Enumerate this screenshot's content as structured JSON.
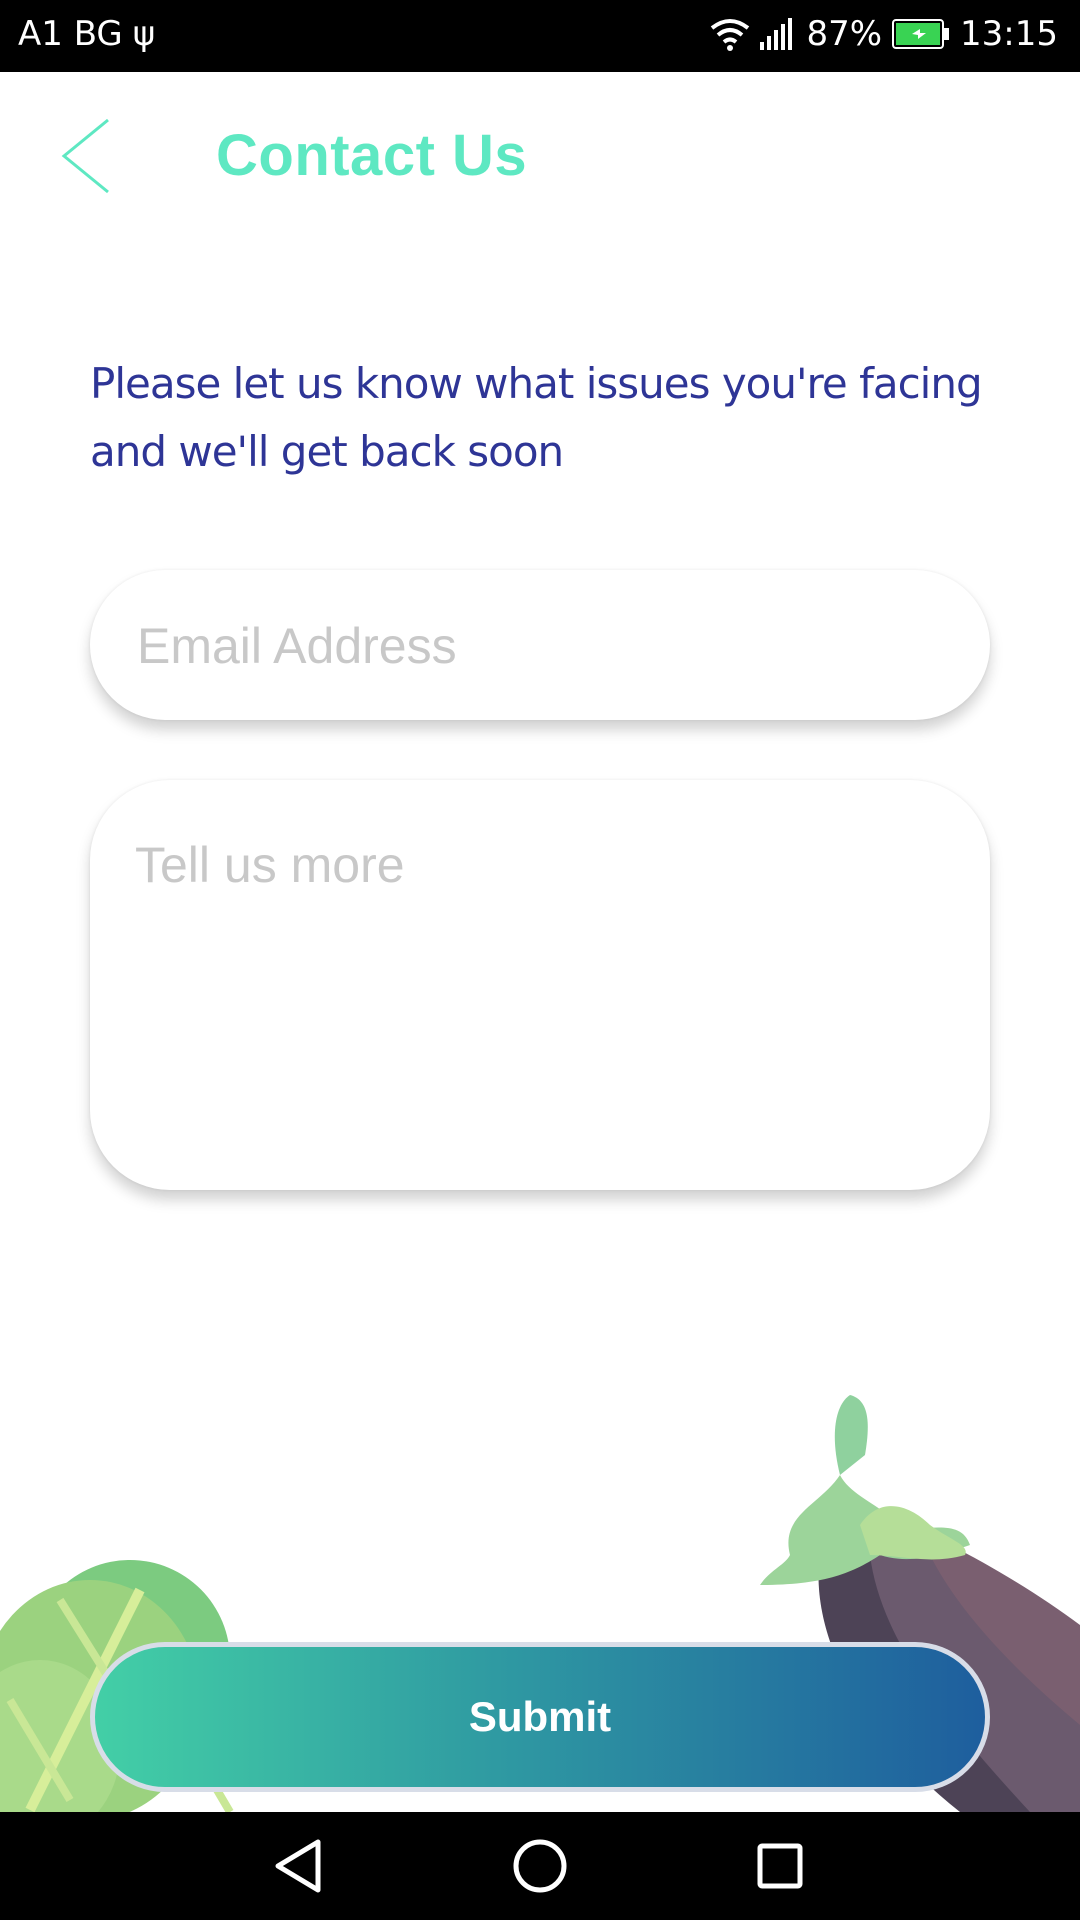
{
  "status_bar": {
    "carrier": "A1 BG",
    "battery": "87%",
    "time": "13:15",
    "icons": [
      "usb-icon",
      "wifi-icon",
      "signal-icon",
      "battery-icon"
    ]
  },
  "header": {
    "back_icon": "chevron-left-icon",
    "title": "Contact Us"
  },
  "intro": {
    "text": "Please let us know what issues you're facing and we'll get back soon"
  },
  "form": {
    "email_placeholder": "Email Address",
    "email_value": "",
    "message_placeholder": "Tell us more",
    "message_value": "",
    "submit_label": "Submit"
  },
  "colors": {
    "title": "#5ee8c2",
    "intro_text": "#2e3596",
    "placeholder": "#c8c8c8",
    "submit_gradient_start": "#43cfa6",
    "submit_gradient_end": "#1e5e9e"
  },
  "nav_bar": {
    "buttons": [
      "back-triangle-icon",
      "home-circle-icon",
      "recents-square-icon"
    ]
  }
}
